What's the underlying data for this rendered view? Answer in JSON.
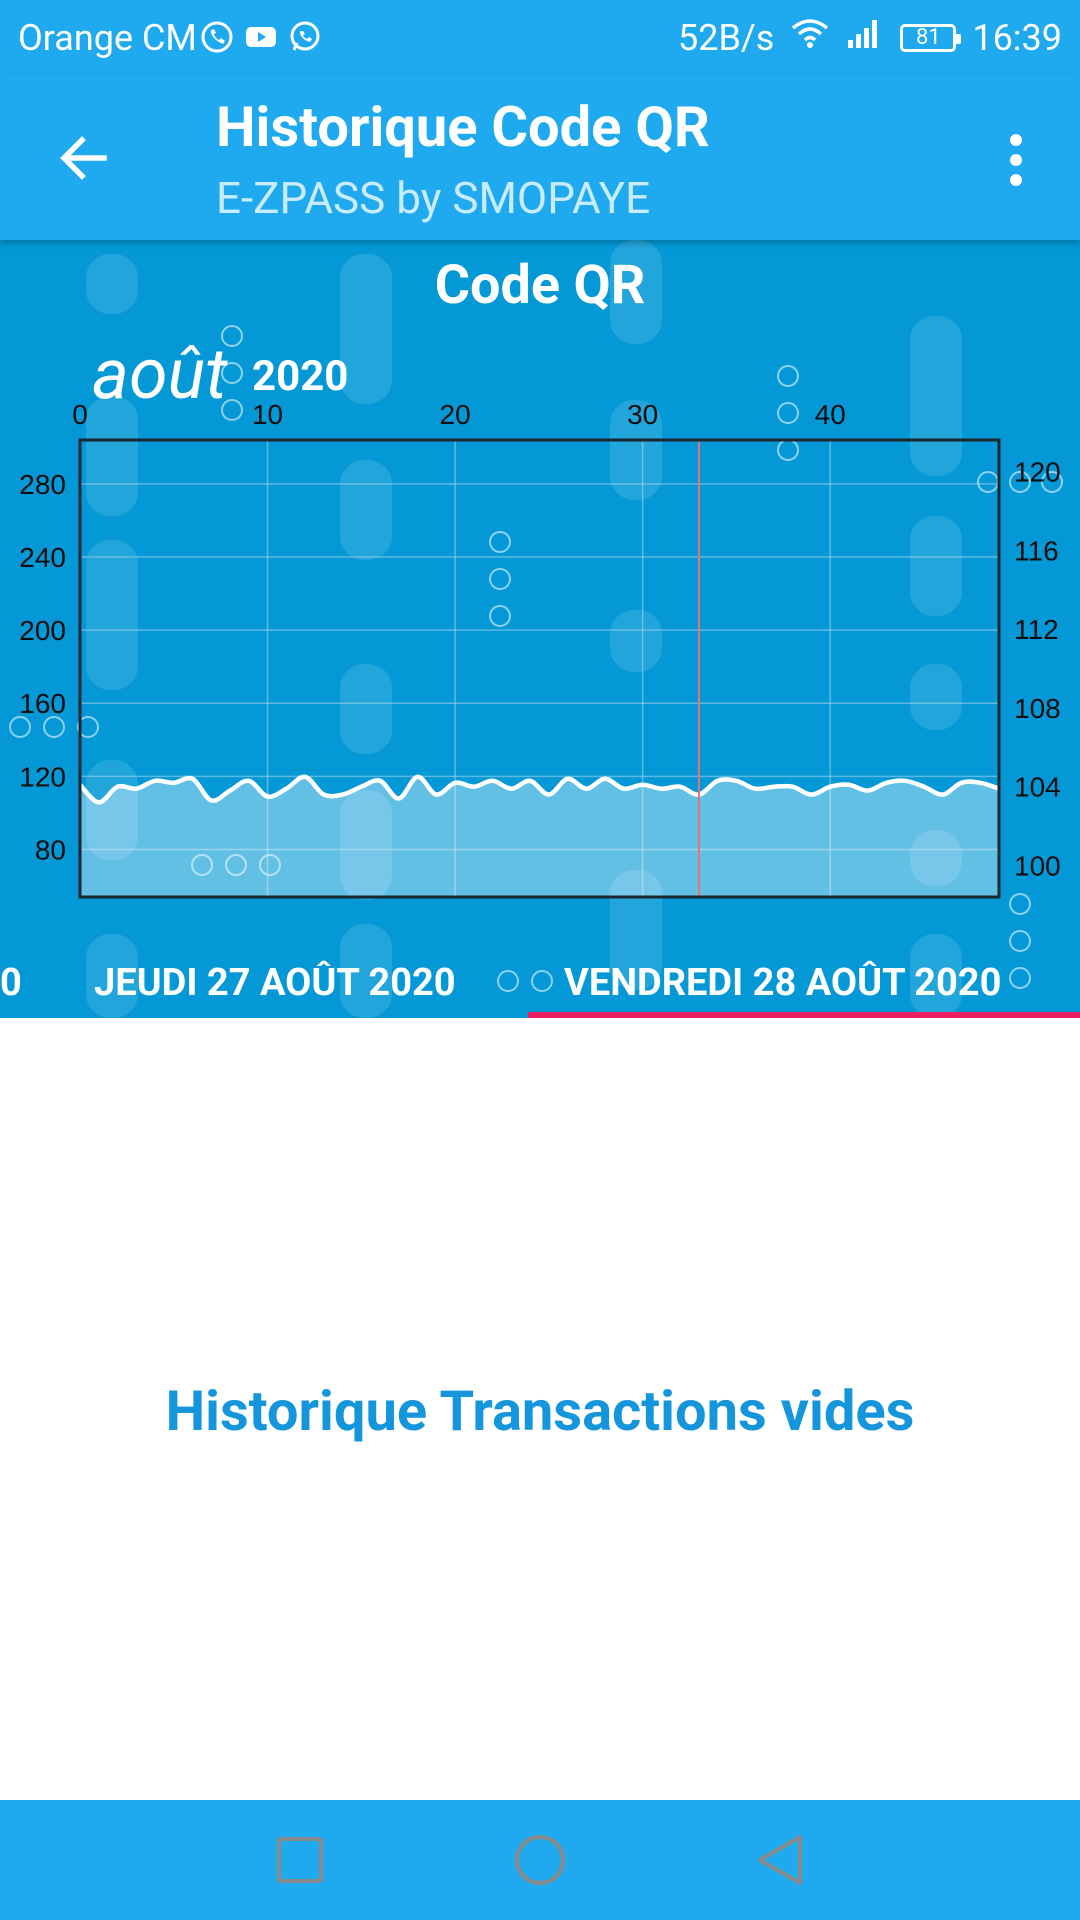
{
  "status_bar": {
    "carrier": "Orange CM",
    "speed": "52B/s",
    "battery": "81",
    "time": "16:39",
    "icons": [
      "phone-icon",
      "youtube-icon",
      "whatsapp-icon",
      "wifi-icon",
      "signal-icon",
      "battery-icon"
    ]
  },
  "toolbar": {
    "title": "Historique Code QR",
    "subtitle": "E-ZPASS by SMOPAYE"
  },
  "header": {
    "card_title": "Code QR",
    "month": "août",
    "year": "2020",
    "tabs": [
      {
        "label": "0",
        "selected": false
      },
      {
        "label": "JEUDI 27 AOÛT 2020",
        "selected": false
      },
      {
        "label": "VENDREDI 28 AOÛT 2020",
        "selected": true
      }
    ],
    "colors": {
      "background": "#0499d6",
      "indicator": "#e91e63",
      "toolbar": "#1fa9ef"
    }
  },
  "chart_data": {
    "type": "area",
    "x_ticks": [
      "0",
      "10",
      "20",
      "30",
      "40"
    ],
    "xlim": [
      0,
      49
    ],
    "y_left_ticks": [
      "280",
      "240",
      "200",
      "160",
      "120",
      "80"
    ],
    "ylim_left": [
      54,
      304
    ],
    "y_right_ticks": [
      "120",
      "116",
      "112",
      "108",
      "104",
      "100"
    ],
    "ylim_right": [
      98.4,
      121.6
    ],
    "grid": true,
    "series": [
      {
        "x": [
          0,
          1,
          2,
          3,
          4,
          5,
          6,
          7,
          8,
          9,
          10,
          11,
          12,
          13,
          14,
          15,
          16,
          17,
          18,
          19,
          20,
          21,
          22,
          23,
          24,
          25,
          26,
          27,
          28,
          29,
          30,
          31,
          32,
          33,
          34,
          35,
          36,
          37,
          38,
          39,
          40,
          41,
          42,
          43,
          44,
          45,
          46,
          47,
          48,
          49
        ],
        "y": [
          104.1,
          103.2,
          104.0,
          103.9,
          104.3,
          104.2,
          104.4,
          103.3,
          103.8,
          104.3,
          103.5,
          103.9,
          104.5,
          103.6,
          103.6,
          104.0,
          104.3,
          103.4,
          104.5,
          103.6,
          104.2,
          104.0,
          104.3,
          103.9,
          104.3,
          103.6,
          104.4,
          103.9,
          104.4,
          103.9,
          104.1,
          103.9,
          104.0,
          103.6,
          104.3,
          104.3,
          103.9,
          104.0,
          104.0,
          103.6,
          104.0,
          104.1,
          103.8,
          104.2,
          104.3,
          104.0,
          103.6,
          104.2,
          104.2,
          103.9
        ]
      }
    ]
  },
  "main": {
    "empty_message": "Historique Transactions vides"
  },
  "nav_bar": {
    "icons": [
      "recents-icon",
      "home-icon",
      "back-nav-icon"
    ]
  }
}
